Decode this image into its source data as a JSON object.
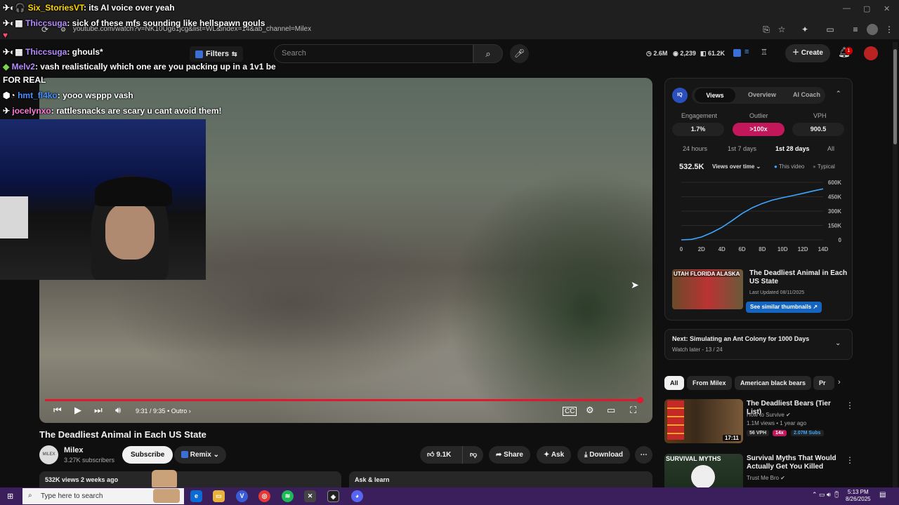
{
  "browser": {
    "url": "youtube.com/watch?v=NK10Ug61jcg&list=WL&index=14&ab_channel=Milex"
  },
  "header": {
    "filters_label": "Filters",
    "search_placeholder": "Search",
    "stats": [
      "2.6M",
      "2,239",
      "61.2K"
    ],
    "create_label": "Create",
    "notif_count": "1"
  },
  "chat": [
    {
      "name": "Six_StoriesVT",
      "msg": ": its AI voice over yeah",
      "color": "#ffd700"
    },
    {
      "name": "Thiccsuga",
      "msg": ": sick of these mfs sounding like hellspawn gouls",
      "color": "#b58cff"
    },
    {
      "name": "Thiccsuga",
      "msg": ": ghouls*",
      "color": "#b58cff"
    },
    {
      "name": "Melv2",
      "msg": ": vash realistically which one are you packing up in a 1v1 be",
      "color": "#b58cff"
    },
    {
      "name": "",
      "msg": "FOR REAL",
      "color": "#ffffff"
    },
    {
      "name": "hmt_fl4ko",
      "msg": ": yooo wsppp vash",
      "color": "#4a90ff"
    },
    {
      "name": "jocelynxo",
      "msg": ": rattlesnacks are scary u cant avoid them!",
      "color": "#ff7ad9"
    }
  ],
  "video": {
    "time": "9:31 / 9:35",
    "chapter": "• Outro",
    "progress": 0.993,
    "title": "The Deadliest Animal in Each US State"
  },
  "channel": {
    "avatar_text": "MILEX",
    "name": "Milex",
    "subs": "3.27K subscribers",
    "subscribe_label": "Subscribe",
    "remix_label": "Remix"
  },
  "actions": {
    "likes": "9.1K",
    "share": "Share",
    "ask": "Ask",
    "download": "Download"
  },
  "description": {
    "meta": "532K views  2 weeks ago",
    "ask_learn": "Ask & learn"
  },
  "panel": {
    "tabs": [
      "Views",
      "Overview",
      "AI Coach"
    ],
    "metrics": [
      {
        "label": "Engagement",
        "value": "1.7%"
      },
      {
        "label": "Outlier",
        "value": ">100x"
      },
      {
        "label": "VPH",
        "value": "900.5"
      }
    ],
    "periods": [
      "24 hours",
      "1st 7 days",
      "1st 28 days",
      "All"
    ],
    "views_total": "532.5K",
    "views_over_time": "Views over time",
    "legend_this": "This video",
    "legend_typical": "Typical",
    "colors": {
      "accent": "#3ea6ff",
      "outlier": "#c2185b"
    }
  },
  "chart_data": {
    "type": "line",
    "x_ticks": [
      "0",
      "2D",
      "4D",
      "6D",
      "8D",
      "10D",
      "12D",
      "14D"
    ],
    "y_ticks": [
      "600K",
      "450K",
      "300K",
      "150K",
      "0"
    ],
    "ylim": [
      0,
      600000
    ],
    "series": [
      {
        "name": "This video",
        "x": [
          0,
          1,
          2,
          3,
          4,
          5,
          6,
          7,
          8,
          9,
          10,
          11,
          12,
          13,
          14
        ],
        "values": [
          0,
          5000,
          30000,
          75000,
          130000,
          200000,
          275000,
          335000,
          380000,
          415000,
          440000,
          462000,
          485000,
          510000,
          532500
        ]
      }
    ]
  },
  "thumb_card": {
    "thumb_text": "UTAH FLORIDA ALASKA",
    "title": "The Deadliest Animal in Each US State",
    "date": "Last Updated 08/11/2025",
    "see_similar": "See similar thumbnails"
  },
  "next": {
    "title": "Next: Simulating an Ant Colony for 1000 Days",
    "sub": "Watch later - 13 / 24"
  },
  "chips": [
    "All",
    "From Milex",
    "American black bears",
    "Pr"
  ],
  "recs": [
    {
      "title": "The Deadliest Bears (Tier List)",
      "channel": "How to Survive",
      "meta": "1.1M views • 1 year ago",
      "duration": "17:11",
      "vph": "56 VPH",
      "mult": "14x",
      "subs": "2.07M Subs"
    },
    {
      "title": "Survival Myths That Would Actually Get You Killed",
      "channel": "Trust Me Bro",
      "meta": "",
      "duration": "",
      "vph": "",
      "mult": "",
      "subs": ""
    }
  ],
  "taskbar": {
    "search_placeholder": "Type here to search",
    "time": "5:13 PM",
    "date": "8/26/2025"
  }
}
